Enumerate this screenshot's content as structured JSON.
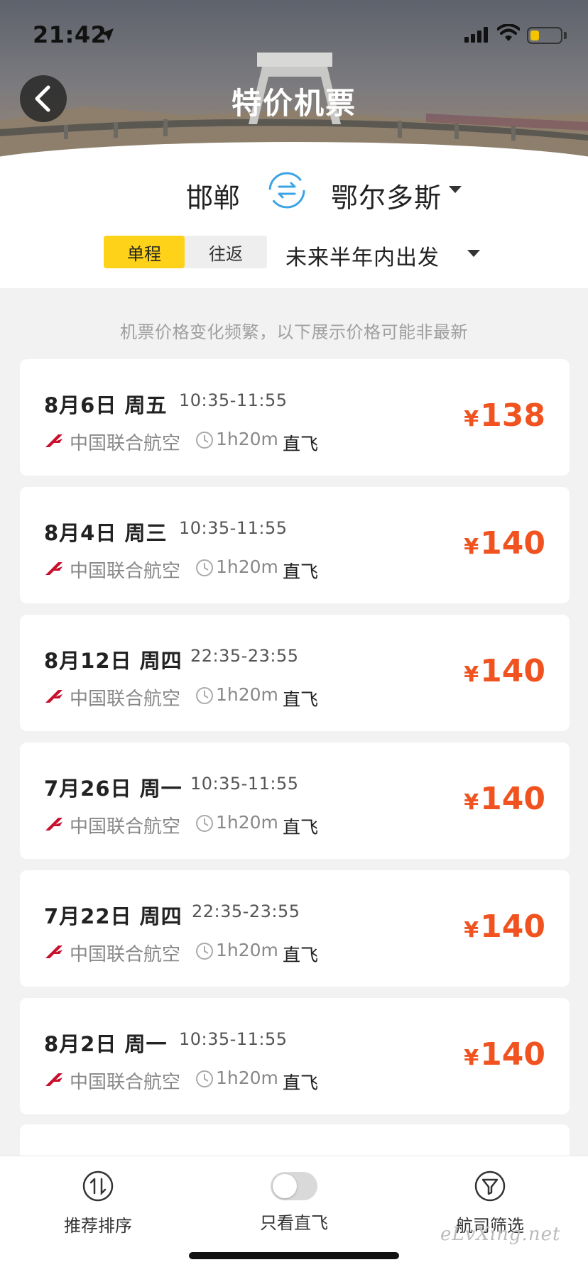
{
  "status_bar": {
    "time": "21:42"
  },
  "header": {
    "title": "特价机票"
  },
  "route": {
    "from": "邯郸",
    "to": "鄂尔多斯",
    "trip_types": {
      "oneway": "单程",
      "roundtrip": "往返",
      "selected": "单程"
    },
    "date_range": "未来半年内出发"
  },
  "notice": "机票价格变化频繁，以下展示价格可能非最新",
  "colors": {
    "accent_yellow": "#ffd21a",
    "price_red": "#f0531f",
    "airline_red": "#c8102e"
  },
  "flights": [
    {
      "date": "8月6日 周五",
      "time": "10:35-11:55",
      "airline": "中国联合航空",
      "duration": "1h20m",
      "type": "直飞",
      "currency": "¥",
      "price": "138"
    },
    {
      "date": "8月4日 周三",
      "time": "10:35-11:55",
      "airline": "中国联合航空",
      "duration": "1h20m",
      "type": "直飞",
      "currency": "¥",
      "price": "140"
    },
    {
      "date": "8月12日 周四",
      "time": "22:35-23:55",
      "airline": "中国联合航空",
      "duration": "1h20m",
      "type": "直飞",
      "currency": "¥",
      "price": "140"
    },
    {
      "date": "7月26日 周一",
      "time": "10:35-11:55",
      "airline": "中国联合航空",
      "duration": "1h20m",
      "type": "直飞",
      "currency": "¥",
      "price": "140"
    },
    {
      "date": "7月22日 周四",
      "time": "22:35-23:55",
      "airline": "中国联合航空",
      "duration": "1h20m",
      "type": "直飞",
      "currency": "¥",
      "price": "140"
    },
    {
      "date": "8月2日 周一",
      "time": "10:35-11:55",
      "airline": "中国联合航空",
      "duration": "1h20m",
      "type": "直飞",
      "currency": "¥",
      "price": "140"
    }
  ],
  "bottom_bar": {
    "sort_label": "推荐排序",
    "direct_only_label": "只看直飞",
    "direct_only_on": false,
    "airline_filter_label": "航司筛选"
  },
  "watermark": "eLvXing.net"
}
